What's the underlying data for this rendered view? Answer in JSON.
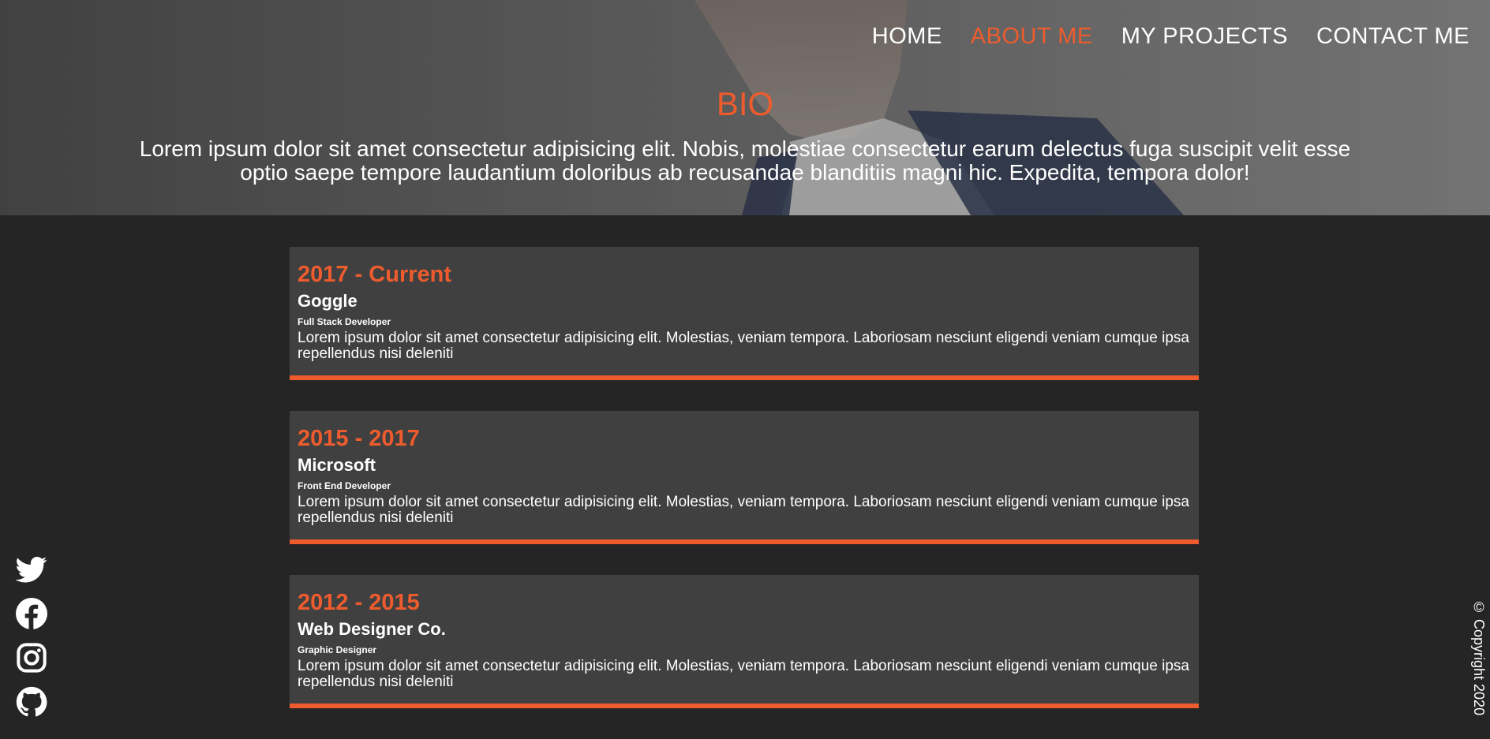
{
  "nav": {
    "items": [
      {
        "label": "HOME",
        "active": false
      },
      {
        "label": "ABOUT ME",
        "active": true
      },
      {
        "label": "MY PROJECTS",
        "active": false
      },
      {
        "label": "CONTACT ME",
        "active": false
      }
    ]
  },
  "hero": {
    "title": "BIO",
    "text": "Lorem ipsum dolor sit amet consectetur adipisicing elit. Nobis, molestiae consectetur earum delectus fuga suscipit velit esse optio saepe tempore laudantium doloribus ab recusandae blanditiis magni hic. Expedita, tempora dolor!"
  },
  "timeline": [
    {
      "years": "2017 - Current",
      "company": "Goggle",
      "role": "Full Stack Developer",
      "description": "Lorem ipsum dolor sit amet consectetur adipisicing elit. Molestias, veniam tempora. Laboriosam nesciunt eligendi veniam cumque ipsa repellendus nisi deleniti"
    },
    {
      "years": "2015 - 2017",
      "company": "Microsoft",
      "role": "Front End Developer",
      "description": "Lorem ipsum dolor sit amet consectetur adipisicing elit. Molestias, veniam tempora. Laboriosam nesciunt eligendi veniam cumque ipsa repellendus nisi deleniti"
    },
    {
      "years": "2012 - 2015",
      "company": "Web Designer Co.",
      "role": "Graphic Designer",
      "description": "Lorem ipsum dolor sit amet consectetur adipisicing elit. Molestias, veniam tempora. Laboriosam nesciunt eligendi veniam cumque ipsa repellendus nisi deleniti"
    }
  ],
  "social": {
    "icons": [
      "twitter-icon",
      "facebook-icon",
      "instagram-icon",
      "github-icon"
    ]
  },
  "footer": {
    "copyright": "© Copyright 2020"
  },
  "colors": {
    "accent": "#ee5c2e",
    "background": "#252525",
    "card": "#404040"
  }
}
